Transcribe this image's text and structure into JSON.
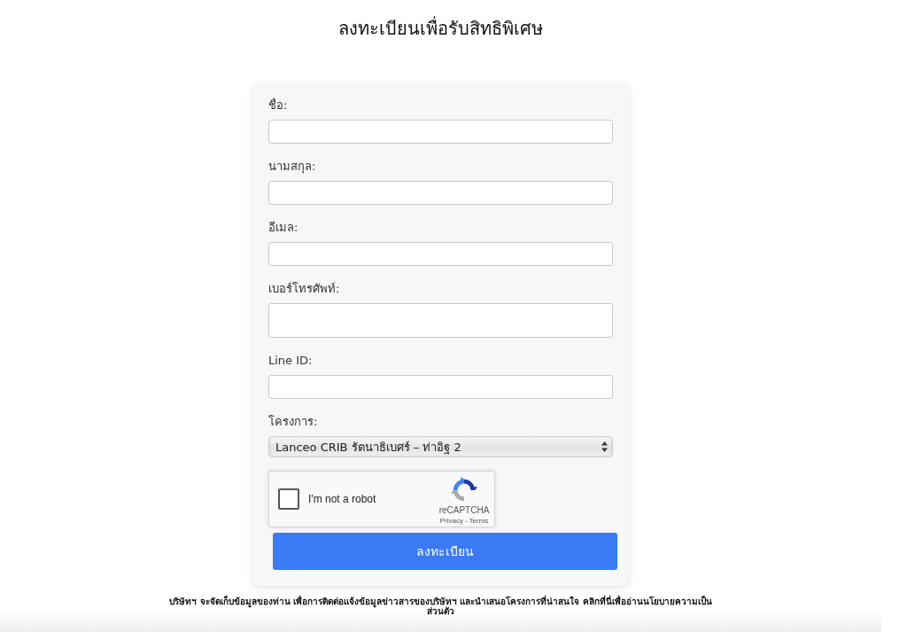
{
  "title": "ลงทะเบียนเพื่อรับสิทธิพิเศษ",
  "form": {
    "fields": [
      {
        "kind": "text",
        "label": "ชื่อ:"
      },
      {
        "kind": "text",
        "label": "นามสกุล:"
      },
      {
        "kind": "text",
        "label": "อีเมล:"
      },
      {
        "kind": "tall",
        "label": "เบอร์โทรศัพท์:"
      },
      {
        "kind": "text",
        "label": "Line ID:"
      },
      {
        "kind": "select",
        "label": "โครงการ:",
        "value": "Lanceo CRIB รัตนาธิเบศร์ – ท่าอิฐ 2"
      }
    ],
    "captcha": {
      "label": "I'm not a robot",
      "checked": false,
      "brand": "reCAPTCHA",
      "links": [
        "Privacy",
        "Terms"
      ],
      "separator": "-"
    },
    "submit": "ลงทะเบียน"
  },
  "footer": "บริษัทฯ จะจัดเก็บข้อมูลของท่าน เพื่อการติดต่อแจ้งข้อมูลข่าวสารของบริษัทฯ และนำเสนอโครงการที่น่าสนใจ คลิกที่นี่เพื่ออ่านนโยบายความเป็นส่วนตัว"
}
